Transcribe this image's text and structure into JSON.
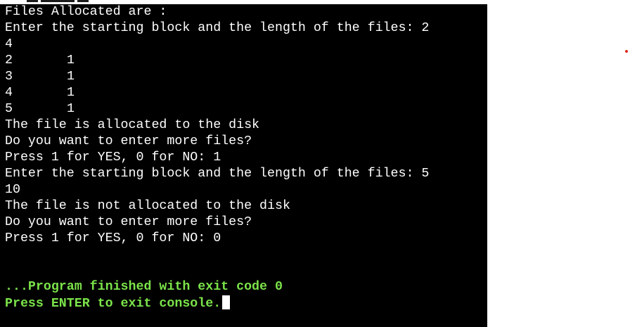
{
  "console": {
    "lines": [
      "Files Allocated are :",
      "Enter the starting block and the length of the files: 2",
      "4",
      "The file is allocated to the disk",
      "Do you want to enter more files?",
      "Press 1 for YES, 0 for NO: 1",
      "Enter the starting block and the length of the files: 5",
      "10",
      "The file is not allocated to the disk",
      "Do you want to enter more files?",
      "Press 1 for YES, 0 for NO: 0"
    ],
    "allocation_rows": [
      {
        "block": "2",
        "flag": "1"
      },
      {
        "block": "3",
        "flag": "1"
      },
      {
        "block": "4",
        "flag": "1"
      },
      {
        "block": "5",
        "flag": "1"
      }
    ],
    "exit_message": "...Program finished with exit code 0",
    "exit_prompt": "Press ENTER to exit console."
  },
  "colors": {
    "console_bg": "#000000",
    "text": "#ffffff",
    "exit_text": "#7be34a",
    "marker": "#e0281f"
  }
}
